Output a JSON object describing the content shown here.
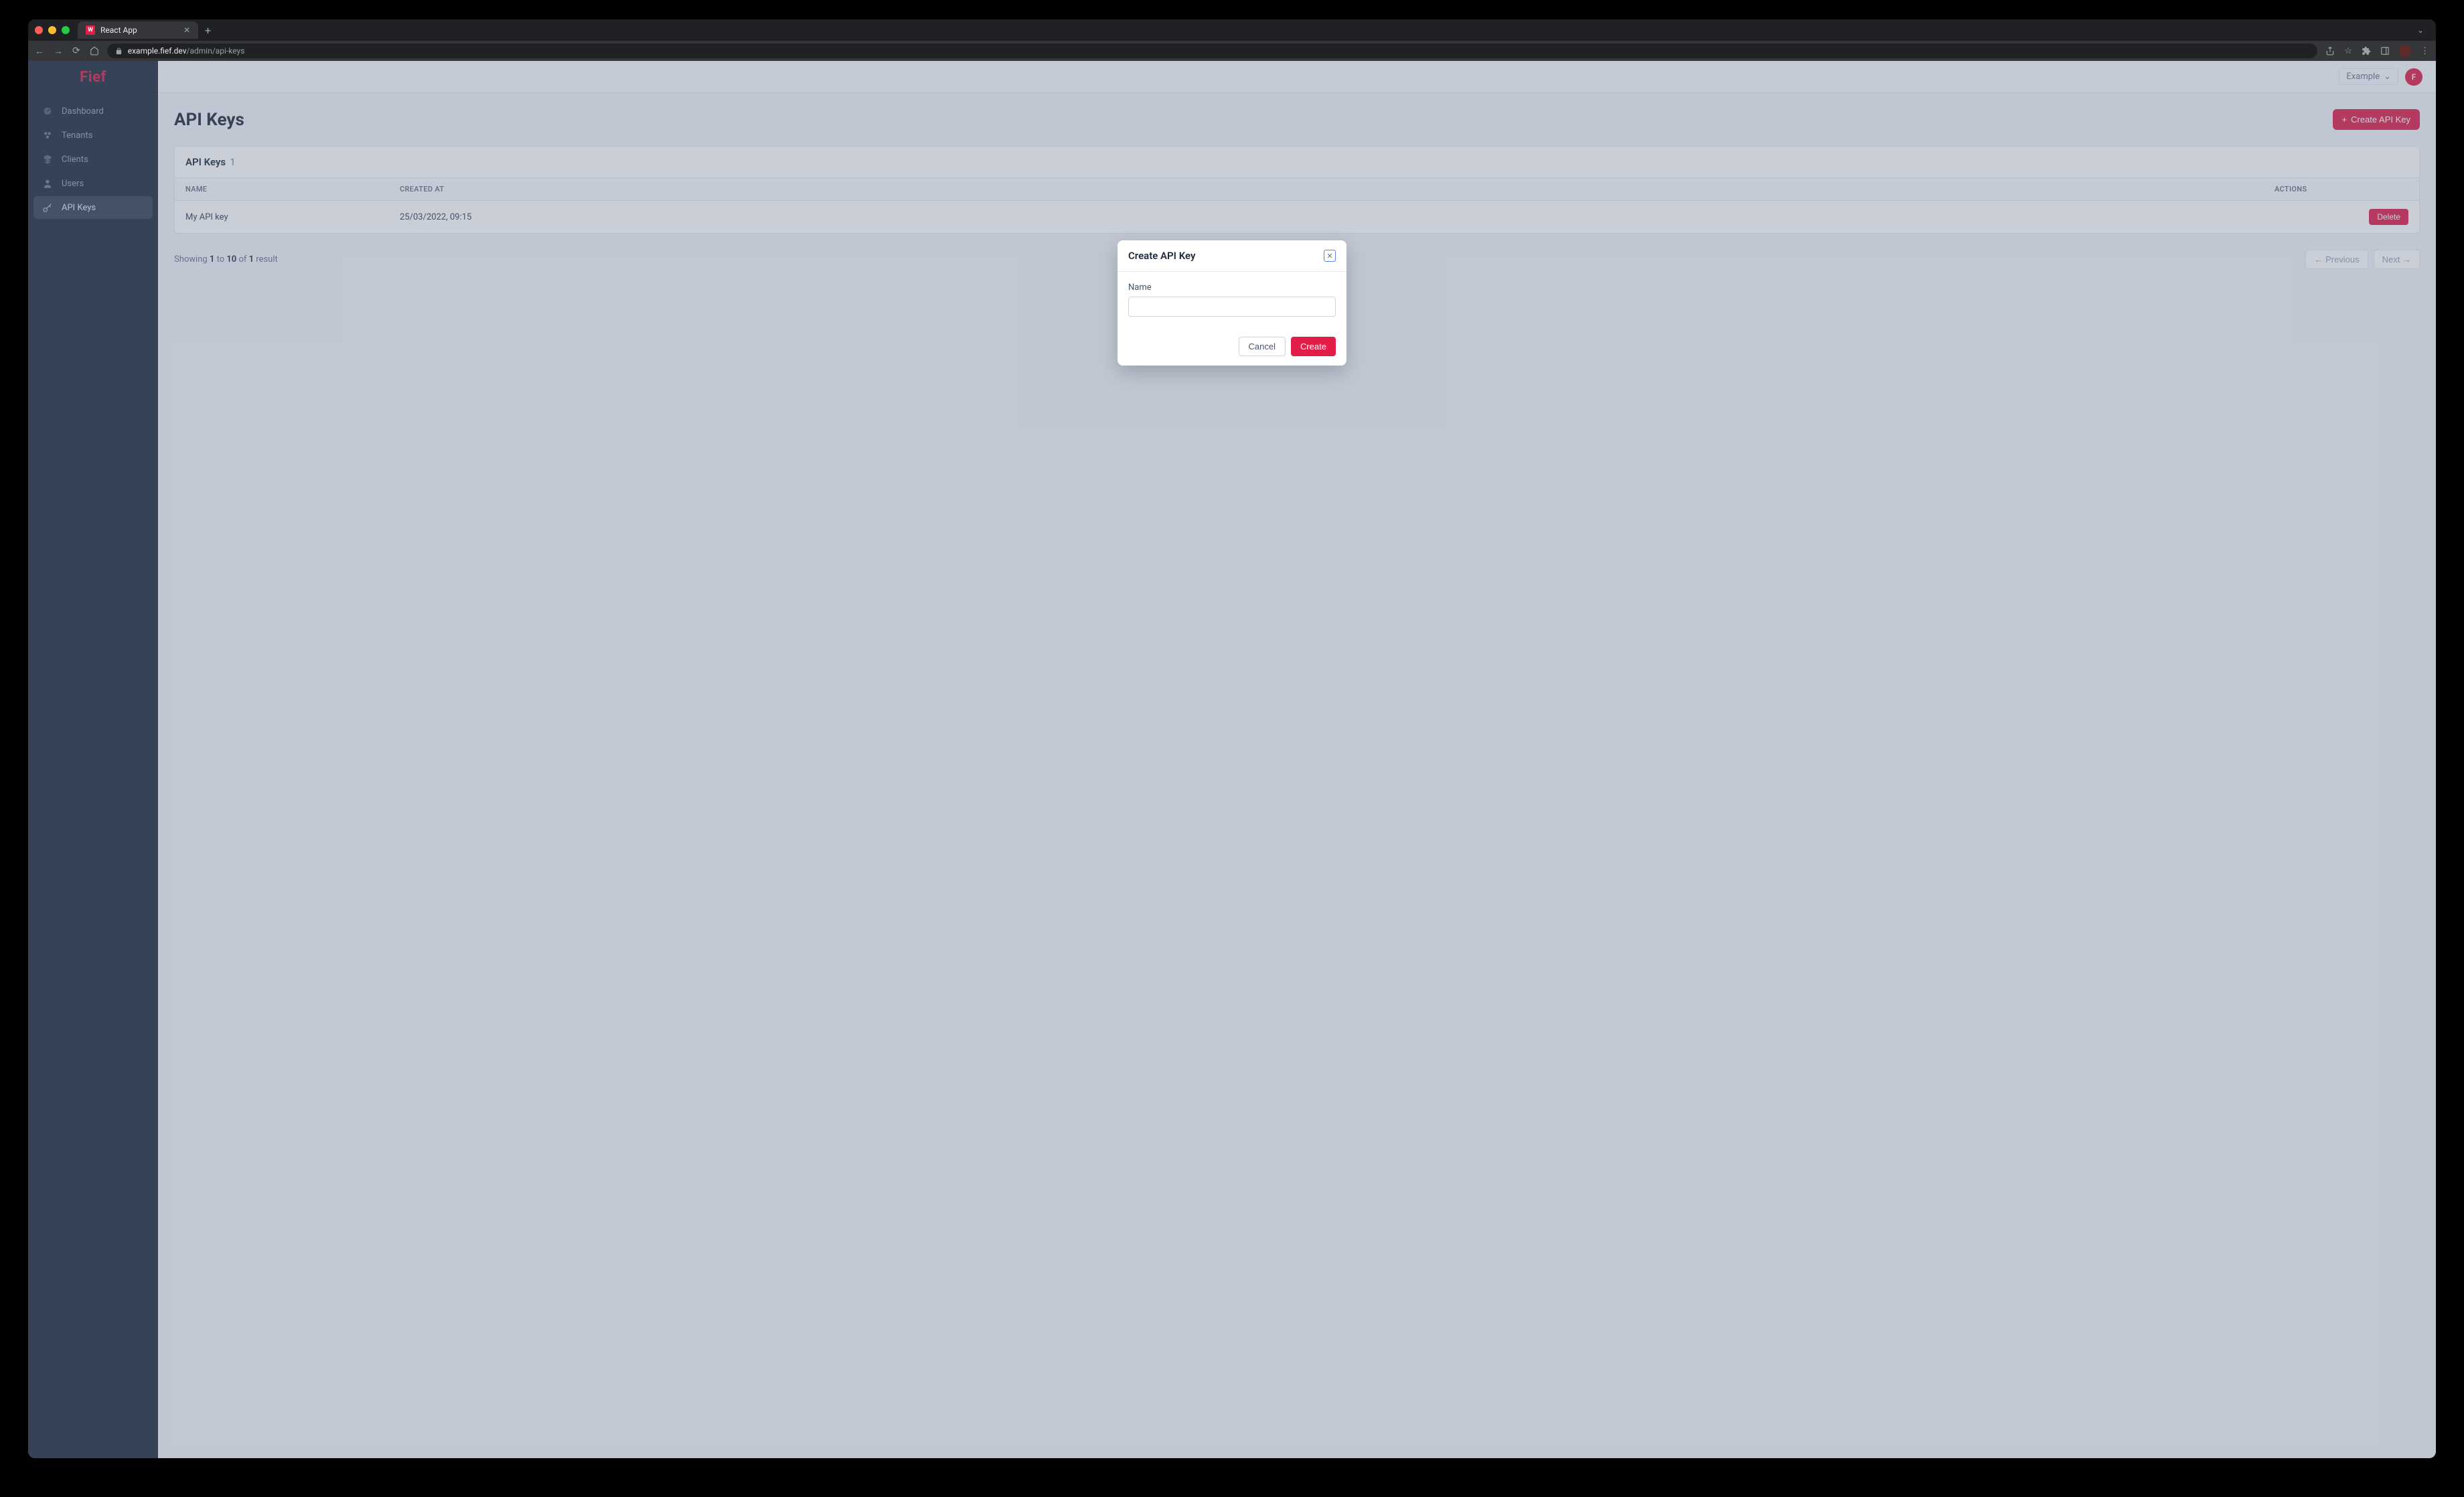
{
  "browser": {
    "tab_title": "React App",
    "url_host": "example.fief.dev",
    "url_path": "/admin/api-keys"
  },
  "app": {
    "logo": "Fief",
    "workspace": "Example",
    "user_initial": "F"
  },
  "sidebar": {
    "items": [
      {
        "label": "Dashboard",
        "icon": "dashboard-icon",
        "active": false
      },
      {
        "label": "Tenants",
        "icon": "tenants-icon",
        "active": false
      },
      {
        "label": "Clients",
        "icon": "clients-icon",
        "active": false
      },
      {
        "label": "Users",
        "icon": "users-icon",
        "active": false
      },
      {
        "label": "API Keys",
        "icon": "api-keys-icon",
        "active": true
      }
    ]
  },
  "page": {
    "title": "API Keys",
    "create_button": "Create API Key"
  },
  "table": {
    "title": "API Keys",
    "count": "1",
    "columns": {
      "name": "NAME",
      "created": "CREATED AT",
      "actions": "ACTIONS"
    },
    "rows": [
      {
        "name": "My API key",
        "created": "25/03/2022, 09:15",
        "delete": "Delete"
      }
    ]
  },
  "pagination": {
    "showing": "Showing ",
    "from": "1",
    "to_word": " to ",
    "to": "10",
    "of_word": " of ",
    "total": "1",
    "result_word": " result",
    "prev": "← Previous",
    "next": "Next →"
  },
  "modal": {
    "title": "Create API Key",
    "name_label": "Name",
    "name_value": "",
    "cancel": "Cancel",
    "create": "Create"
  }
}
